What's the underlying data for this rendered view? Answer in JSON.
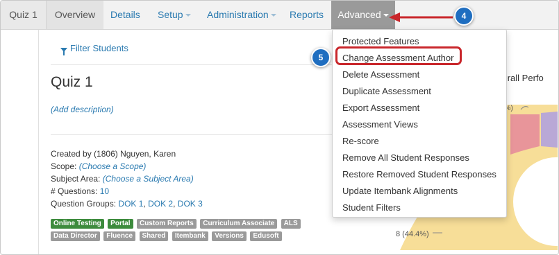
{
  "nav": {
    "brand": "Quiz 1",
    "items": [
      "Overview",
      "Details",
      "Setup",
      "Administration",
      "Reports",
      "Advanced"
    ]
  },
  "filter_link": "Filter Students",
  "quiz": {
    "title": "Quiz 1",
    "add_description": "(Add description)"
  },
  "meta": {
    "created_by_label": "Created by",
    "created_by_value": "(1806) Nguyen, Karen",
    "scope_label": "Scope:",
    "scope_value": "(Choose a Scope)",
    "subject_label": "Subject Area:",
    "subject_value": "(Choose a Subject Area)",
    "questions_label": "# Questions:",
    "questions_value": "10",
    "groups_label": "Question Groups:",
    "groups": [
      "DOK 1",
      "DOK 2",
      "DOK 3"
    ]
  },
  "badges": {
    "row1": [
      {
        "label": "Online Testing",
        "color": "#3d8b3d"
      },
      {
        "label": "Portal",
        "color": "#3d8b3d"
      },
      {
        "label": "Custom Reports",
        "color": "#9a9a9a"
      },
      {
        "label": "Curriculum Associate",
        "color": "#9a9a9a"
      },
      {
        "label": "ALS",
        "color": "#9a9a9a"
      }
    ],
    "row2": [
      {
        "label": "Data Director",
        "color": "#9a9a9a"
      },
      {
        "label": "Fluence",
        "color": "#9a9a9a"
      },
      {
        "label": "Shared",
        "color": "#9a9a9a"
      },
      {
        "label": "Itembank",
        "color": "#9a9a9a"
      },
      {
        "label": "Versions",
        "color": "#9a9a9a"
      },
      {
        "label": "Edusoft",
        "color": "#9a9a9a"
      }
    ]
  },
  "chart": {
    "title_fragment": "verall Perfo",
    "label_top": "6%)",
    "label_bottom": "8 (44.4%)"
  },
  "dropdown": {
    "items": [
      "Protected Features",
      "Change Assessment Author",
      "Delete Assessment",
      "Duplicate Assessment",
      "Export Assessment",
      "Assessment Views",
      "Re-score",
      "Remove All Student Responses",
      "Restore Removed Student Responses",
      "Update Itembank Alignments",
      "Student Filters"
    ],
    "highlighted_index": 1
  },
  "callouts": {
    "step4": "4",
    "step5": "5"
  },
  "colors": {
    "link": "#2a7ab0",
    "active_tab": "#9a9a9a",
    "highlight": "#c9262b",
    "callout": "#1f6ec0",
    "badge_green": "#3d8b3d",
    "badge_gray": "#9a9a9a"
  }
}
